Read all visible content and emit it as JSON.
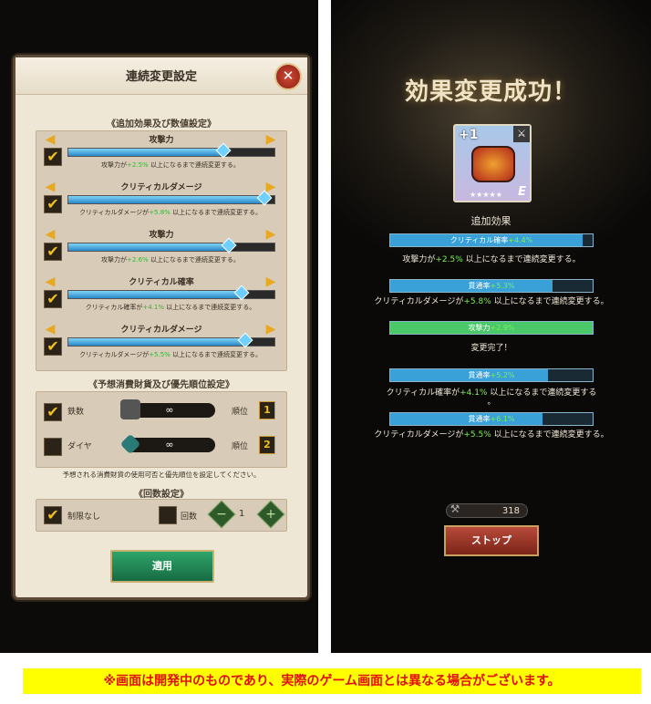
{
  "left_panel": {
    "dialog_title": "連続変更設定",
    "close_icon": "close-icon",
    "section1_title": "《追加効果及び数値設定》",
    "rows": [
      {
        "label": "攻撃力",
        "desc_prefix": "攻撃力が",
        "desc_value": "+2.5%",
        "desc_suffix": "以上になるまで連続変更する。",
        "checked": "✔",
        "level": 0.75
      },
      {
        "label": "クリティカルダメージ",
        "desc_prefix": "クリティカルダメージが",
        "desc_value": "+5.8%",
        "desc_suffix": "以上になるまで連続変更する。",
        "checked": "✔",
        "level": 0.95
      },
      {
        "label": "攻撃力",
        "desc_prefix": "攻撃力が",
        "desc_value": "+2.6%",
        "desc_suffix": "以上になるまで連続変更する。",
        "checked": "✔",
        "level": 0.78
      },
      {
        "label": "クリティカル確率",
        "desc_prefix": "クリティカル確率が",
        "desc_value": "+4.1%",
        "desc_suffix": "以上になるまで連続変更する。",
        "checked": "✔",
        "level": 0.84
      },
      {
        "label": "クリティカルダメージ",
        "desc_prefix": "クリティカルダメージが",
        "desc_value": "+5.5%",
        "desc_suffix": "以上になるまで連続変更する。",
        "checked": "✔",
        "level": 0.86
      }
    ],
    "section2_title": "《予想消費財貨及び優先順位設定》",
    "resources": [
      {
        "name": "鉄数",
        "amount": "∞",
        "rank_label": "順位",
        "rank": "1",
        "checked": "✔"
      },
      {
        "name": "ダイヤ",
        "amount": "∞",
        "rank_label": "順位",
        "rank": "2",
        "checked": ""
      }
    ],
    "note": "予想される消費財貨の使用可否と優先順位を設定してください。",
    "section3_title": "《回数設定》",
    "unlimited_label": "制限なし",
    "unlimited_checked": "✔",
    "count_label": "回数",
    "count_value": "1",
    "minus": "−",
    "plus": "+",
    "apply_label": "適用",
    "arrow_left": "◀",
    "arrow_right": "▶"
  },
  "right_panel": {
    "title": "効果変更成功！",
    "item": {
      "plus": "+1",
      "grade": "E",
      "stars": "★★★★★"
    },
    "additional_effect_label": "追加効果",
    "bars": [
      {
        "name": "クリティカル確率",
        "value": "+4.4%",
        "color": "#3aa0d8",
        "fill": 0.95
      },
      {
        "name": "貫通率",
        "value": "+5.3%",
        "color": "#3aa0d8",
        "fill": 0.8
      },
      {
        "name": "攻撃力",
        "value": "+2.9%",
        "color": "#4ac86a",
        "fill": 1.0
      },
      {
        "name": "貫通率",
        "value": "+5.2%",
        "color": "#3aa0d8",
        "fill": 0.78
      },
      {
        "name": "貫通率",
        "value": "+6.1%",
        "color": "#3aa0d8",
        "fill": 0.75
      }
    ],
    "desc1": {
      "prefix": "攻撃力が",
      "value": "+2.5%",
      "suffix": "以上になるまで連続変更する。"
    },
    "desc2": {
      "prefix": "クリティカルダメージが",
      "value": "+5.8%",
      "suffix": "以上になるまで連続変更する。"
    },
    "complete": "変更完了！",
    "desc3": {
      "prefix": "クリティカル確率が",
      "value": "+4.1%",
      "suffix": "以上になるまで連続変更する"
    },
    "desc3_tail": "。",
    "desc4": {
      "prefix": "クリティカルダメージが",
      "value": "+5.5%",
      "suffix": "以上になるまで連続変更する。"
    },
    "counter": "318",
    "stop_label": "ストップ"
  },
  "footer": "※画面は開発中のものであり、実際のゲーム画面とは異なる場合がございます。"
}
